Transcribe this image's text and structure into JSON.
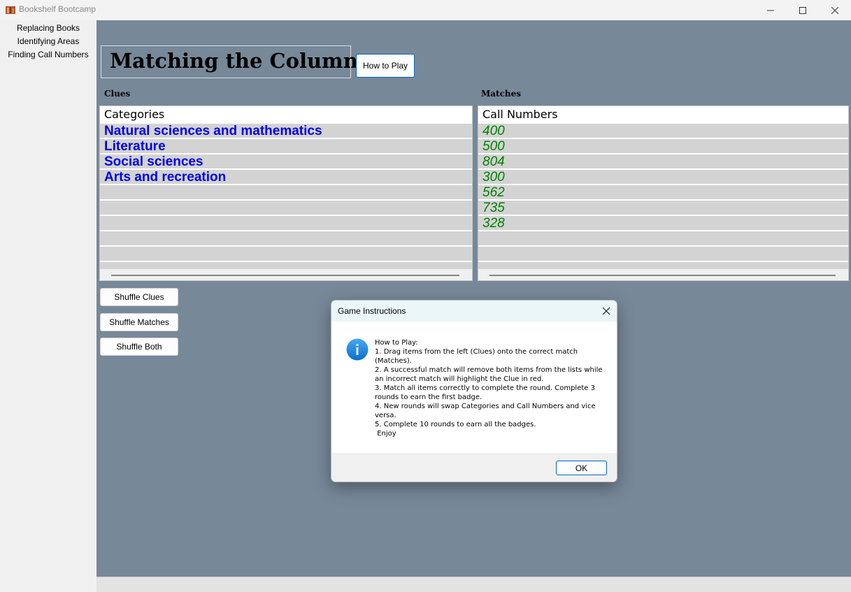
{
  "window": {
    "title": "Bookshelf Bootcamp",
    "icon": "books-app-icon"
  },
  "sidebar": {
    "items": [
      {
        "label": "Replacing Books"
      },
      {
        "label": "Identifying Areas"
      },
      {
        "label": "Finding Call Numbers"
      }
    ]
  },
  "main": {
    "heading": "Matching the Columns",
    "how_to_play_label": "How to Play",
    "clues_label": "Clues",
    "matches_label": "Matches",
    "clues_header": "Categories",
    "matches_header": "Call Numbers",
    "clues": [
      "Natural sciences and mathematics",
      "Literature",
      "Social sciences",
      "Arts and recreation"
    ],
    "matches": [
      "400",
      "500",
      "804",
      "300",
      "562",
      "735",
      "328"
    ],
    "buttons": {
      "shuffle_clues": "Shuffle Clues",
      "shuffle_matches": "Shuffle Matches",
      "shuffle_both": "Shuffle Both"
    },
    "colors": {
      "background": "#778899",
      "clue_text": "#0000ee",
      "match_text": "#008000",
      "row_background": "#d3d3d3"
    }
  },
  "dialog": {
    "title": "Game Instructions",
    "icon": "info-icon",
    "message": "How to Play:\n1. Drag items from the left (Clues) onto the correct match (Matches).\n2. A successful match will remove both items from the lists while an incorrect match will highlight the Clue in red.\n3. Match all items correctly to complete the round. Complete 3 rounds to earn the first badge.\n4. New rounds will swap Categories and Call Numbers and vice versa.\n5. Complete 10 rounds to earn all the badges.\n Enjoy",
    "ok_label": "OK"
  }
}
